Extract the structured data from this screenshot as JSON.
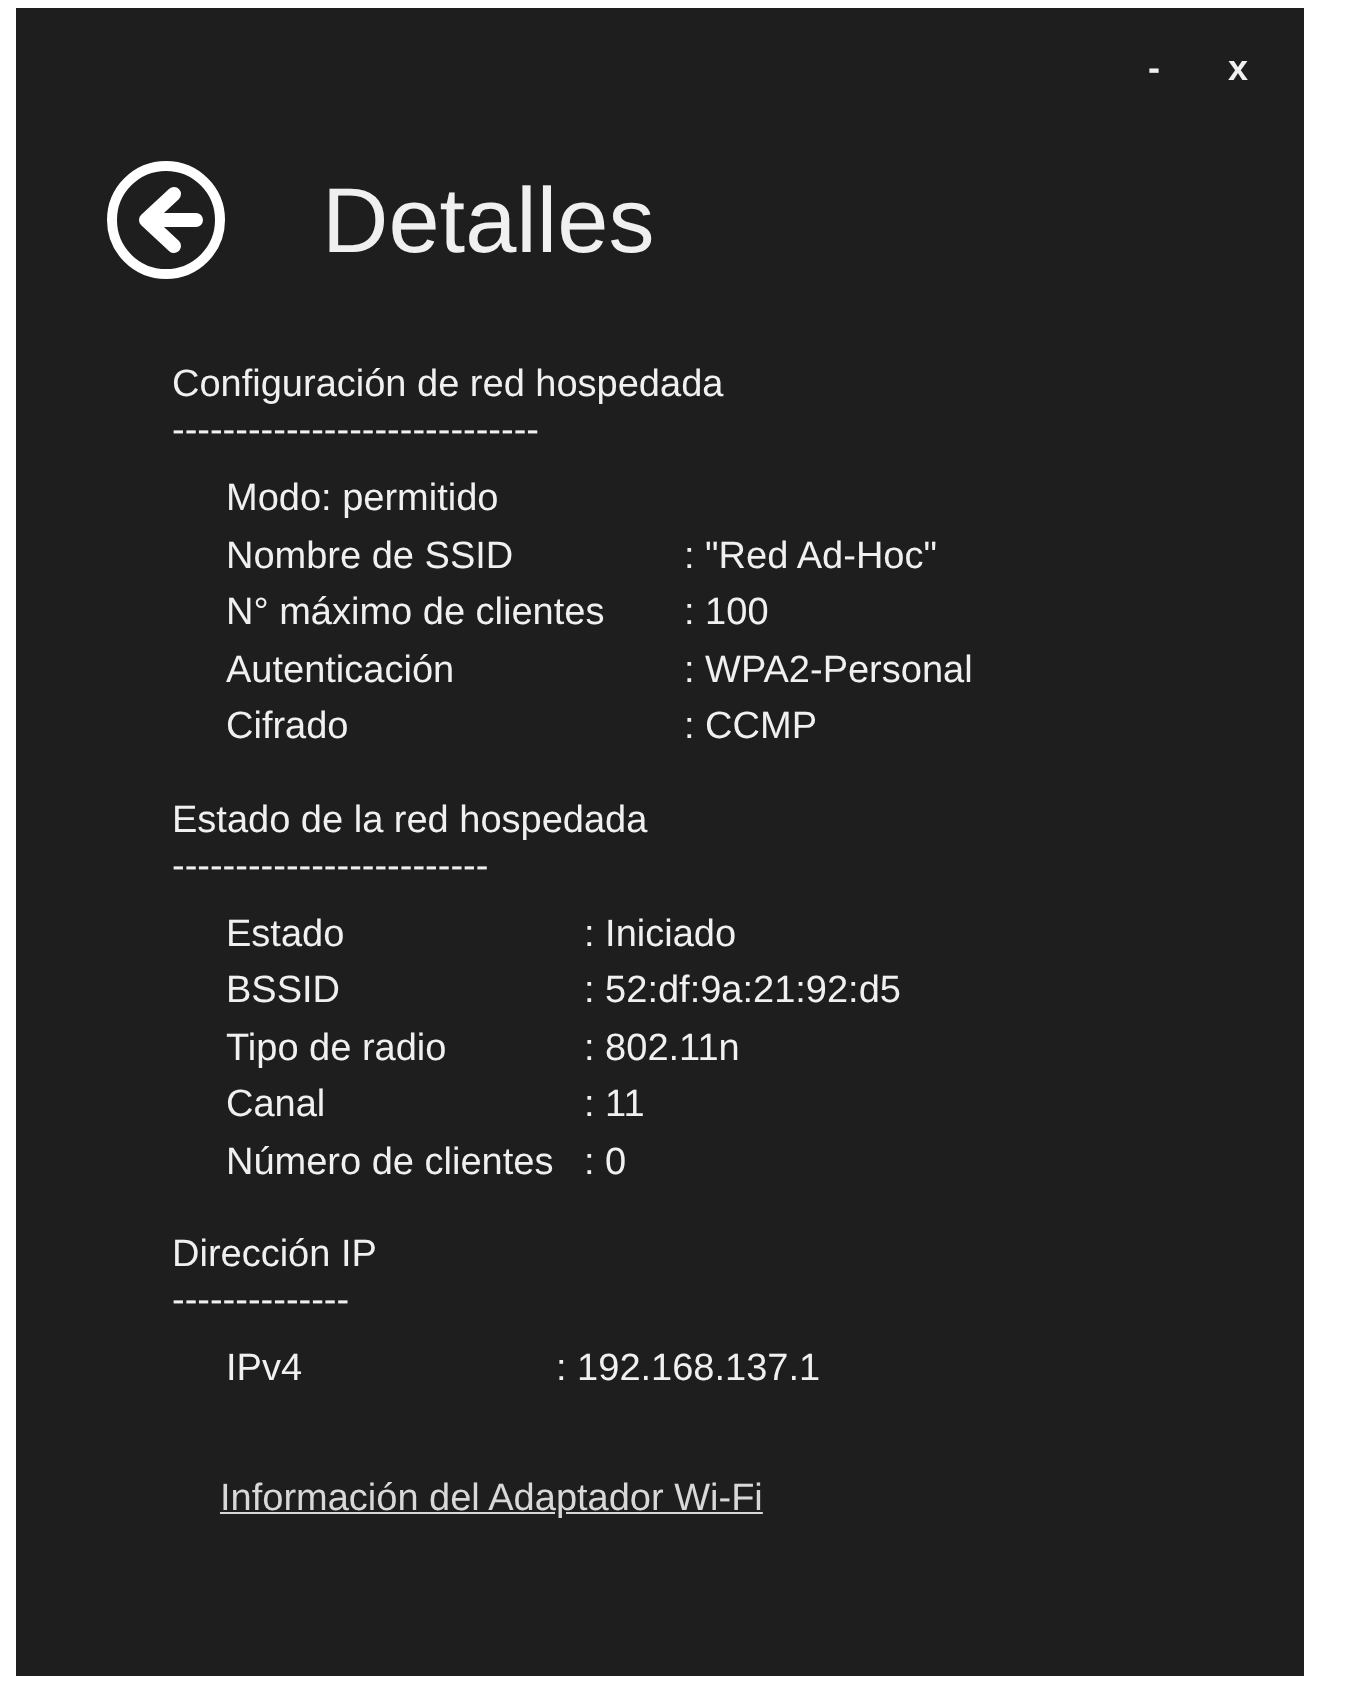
{
  "window": {
    "minimize": "-",
    "close": "x"
  },
  "header": {
    "title": "Detalles"
  },
  "sections": [
    {
      "heading": "Configuración de red hospedada",
      "rule": "-----------------------------",
      "rows": [
        {
          "label": "Modo: permitido"
        },
        {
          "label": "Nombre de SSID",
          "value": ": \"Red Ad-Hoc\""
        },
        {
          "label": "N° máximo de clientes",
          "value": ": 100"
        },
        {
          "label": "Autenticación",
          "value": ": WPA2-Personal"
        },
        {
          "label": "Cifrado",
          "value": ": CCMP"
        }
      ]
    },
    {
      "heading": "Estado de la red hospedada",
      "rule": "-------------------------",
      "rows": [
        {
          "label": "Estado",
          "value": ": Iniciado"
        },
        {
          "label": "BSSID",
          "value": ": 52:df:9a:21:92:d5"
        },
        {
          "label": "Tipo de radio",
          "value": ": 802.11n"
        },
        {
          "label": "Canal",
          "value": ": 11"
        },
        {
          "label": "Número de clientes",
          "value": ": 0"
        }
      ]
    },
    {
      "heading": "Dirección IP",
      "rule": "--------------",
      "rows": [
        {
          "label": "IPv4",
          "value": ": 192.168.137.1"
        }
      ]
    }
  ],
  "link": "Información del Adaptador Wi-Fi"
}
